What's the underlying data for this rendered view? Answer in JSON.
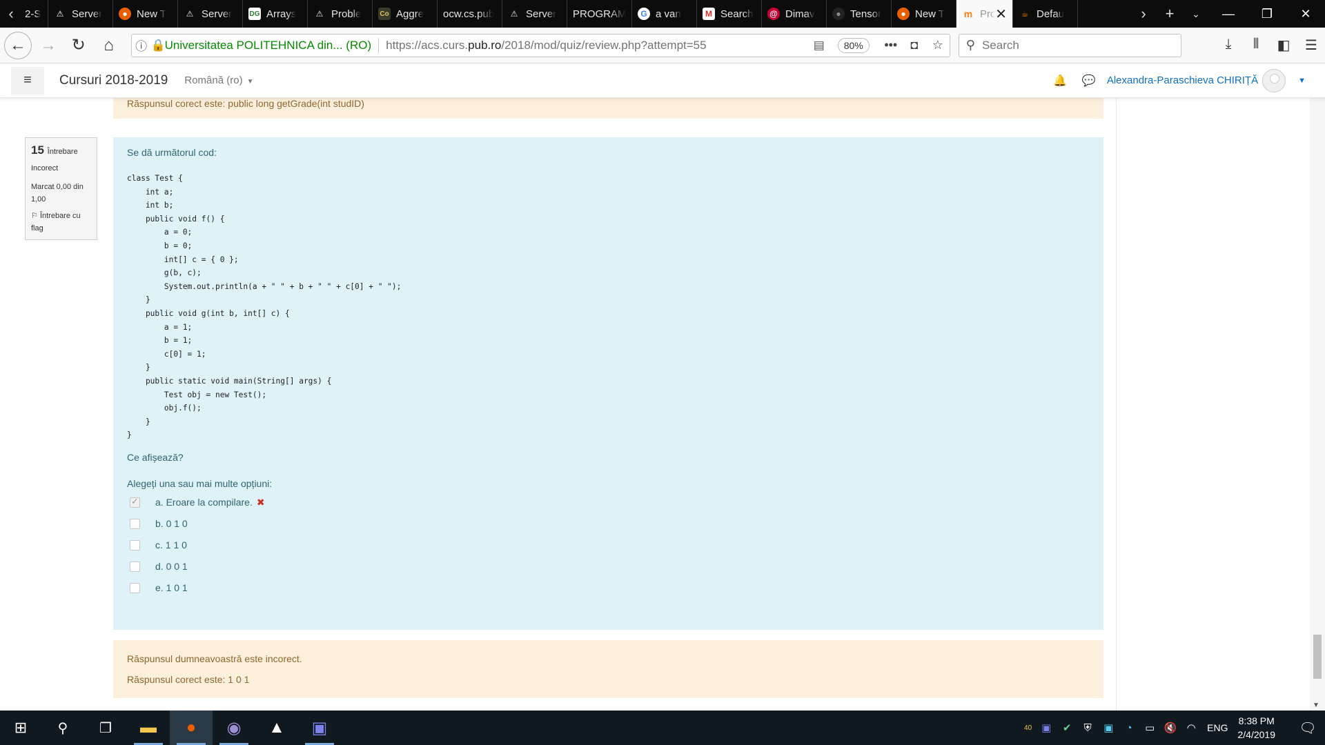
{
  "browser": {
    "tabs": [
      {
        "label": "2-S",
        "icon": "page-icon"
      },
      {
        "label": "Server",
        "icon": "warning-icon"
      },
      {
        "label": "New T",
        "icon": "firefox-icon"
      },
      {
        "label": "Server",
        "icon": "warning-icon"
      },
      {
        "label": "Arrays",
        "icon": "dg-icon"
      },
      {
        "label": "Proble",
        "icon": "warning-icon"
      },
      {
        "label": "Aggre",
        "icon": "co-icon"
      },
      {
        "label": "ocw.cs.pub",
        "icon": ""
      },
      {
        "label": "Server",
        "icon": "warning-icon"
      },
      {
        "label": "PROGRAM",
        "icon": ""
      },
      {
        "label": "a van",
        "icon": "google-icon"
      },
      {
        "label": "Search",
        "icon": "gmail-icon"
      },
      {
        "label": "Dimav",
        "icon": "debian-icon"
      },
      {
        "label": "Tensor",
        "icon": "github-icon"
      },
      {
        "label": "New T",
        "icon": "firefox-icon"
      },
      {
        "label": "Pro",
        "icon": "moodle-icon",
        "active": true
      },
      {
        "label": "Defau",
        "icon": "java-icon"
      }
    ],
    "url_identity": "Universitatea POLITEHNICA din... (RO)",
    "url_prefix": "https://acs.curs.",
    "url_domain": "pub.ro",
    "url_path": "/2018/mod/quiz/review.php?attempt=55",
    "zoom": "80%",
    "search_placeholder": "Search"
  },
  "moodle": {
    "site_name": "Cursuri 2018-2019",
    "language": "Română (ro)",
    "user_name": "Alexandra-Paraschieva CHIRIȚĂ"
  },
  "previous_feedback": {
    "text": "Răspunsul corect este: public long getGrade(int studID)"
  },
  "question": {
    "number": "15",
    "word": "Întrebare",
    "state": "Incorect",
    "grade": "Marcat 0,00 din 1,00",
    "flag": "Întrebare cu flag",
    "intro": "Se dă următorul cod:",
    "code": "class Test {\n    int a;\n    int b;\n    public void f() {\n        a = 0;\n        b = 0;\n        int[] c = { 0 };\n        g(b, c);\n        System.out.println(a + \" \" + b + \" \" + c[0] + \" \");\n    }\n    public void g(int b, int[] c) {\n        a = 1;\n        b = 1;\n        c[0] = 1;\n    }\n    public static void main(String[] args) {\n        Test obj = new Test();\n        obj.f();\n    }\n}",
    "prompt": "Ce afișează?",
    "answer_prompt": "Alegeți una sau mai multe opțiuni:",
    "options": [
      {
        "label": "a. Eroare la compilare.",
        "checked": true,
        "incorrect": true
      },
      {
        "label": "b. 0 1 0",
        "checked": false
      },
      {
        "label": "c. 1 1 0",
        "checked": false
      },
      {
        "label": "d. 0 0 1",
        "checked": false
      },
      {
        "label": "e. 1 0 1",
        "checked": false
      }
    ]
  },
  "outcome": {
    "line1": "Răspunsul dumneavoastră este incorect.",
    "line2": "Răspunsul corect este: 1 0 1"
  },
  "taskbar": {
    "badge": "40",
    "language": "ENG",
    "time": "8:38 PM",
    "date": "2/4/2019"
  }
}
